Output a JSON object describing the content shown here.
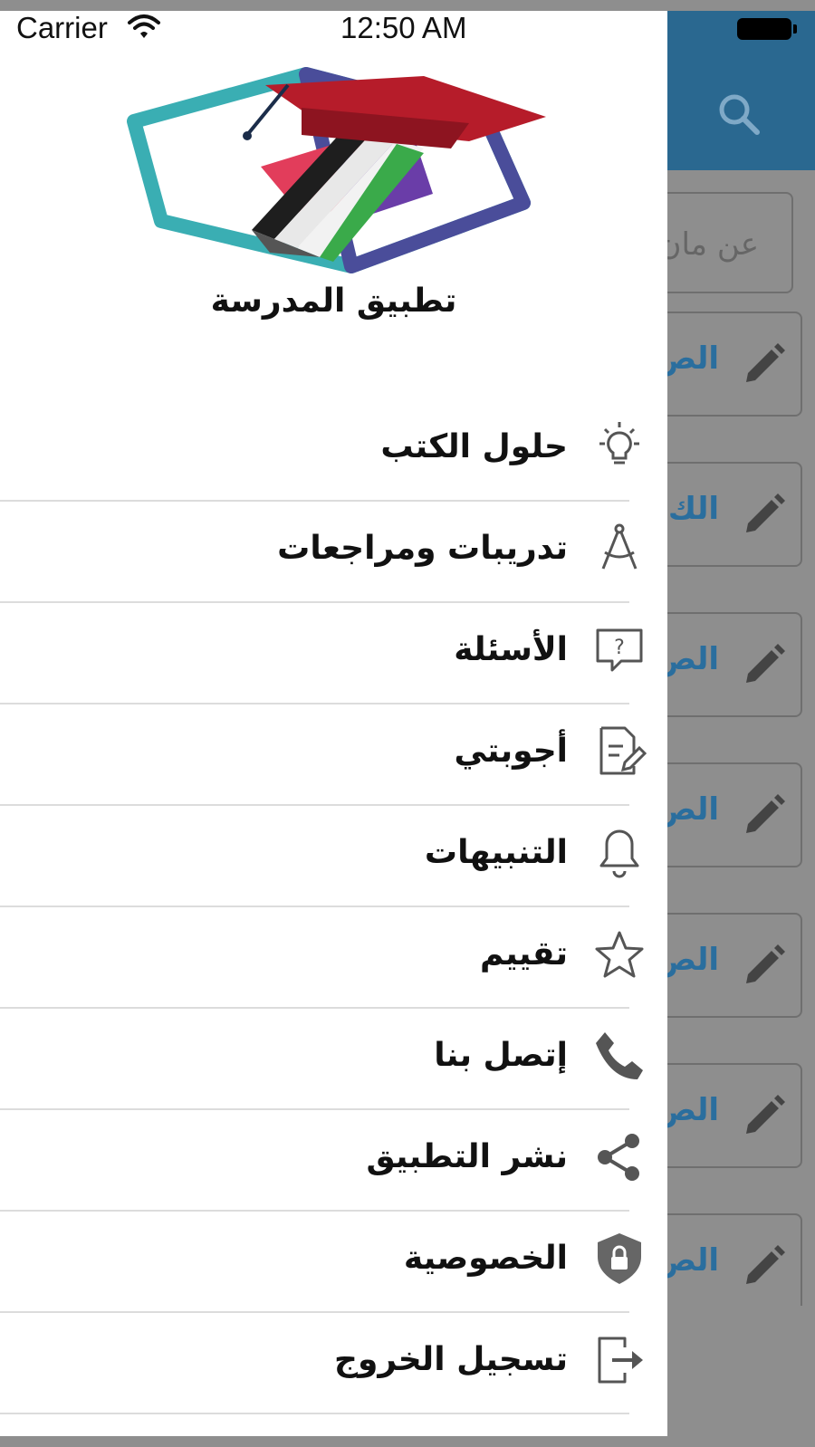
{
  "status_bar": {
    "carrier": "Carrier",
    "time": "12:50 AM"
  },
  "app": {
    "title": "تطبيق المدرسة"
  },
  "background": {
    "search_placeholder": "عن مان",
    "card_labels": [
      "الص",
      "الك",
      "الص",
      "الص",
      "الص",
      "الص",
      "الص"
    ]
  },
  "menu": {
    "items": [
      {
        "label": "حلول الكتب",
        "icon": "lightbulb-icon"
      },
      {
        "label": "تدريبات ومراجعات",
        "icon": "compass-icon"
      },
      {
        "label": "الأسئلة",
        "icon": "question-chat-icon"
      },
      {
        "label": "أجوبتي",
        "icon": "document-edit-icon"
      },
      {
        "label": "التنبيهات",
        "icon": "bell-icon"
      },
      {
        "label": "تقييم",
        "icon": "star-icon"
      },
      {
        "label": "إتصل بنا",
        "icon": "phone-icon"
      },
      {
        "label": "نشر التطبيق",
        "icon": "share-icon"
      },
      {
        "label": "الخصوصية",
        "icon": "shield-lock-icon"
      },
      {
        "label": "تسجيل الخروج",
        "icon": "logout-icon"
      }
    ]
  },
  "colors": {
    "header_blue": "#2a6890",
    "link_blue": "#2a6e9e",
    "icon_gray": "#555555",
    "overlay": "#8e8e8e"
  }
}
